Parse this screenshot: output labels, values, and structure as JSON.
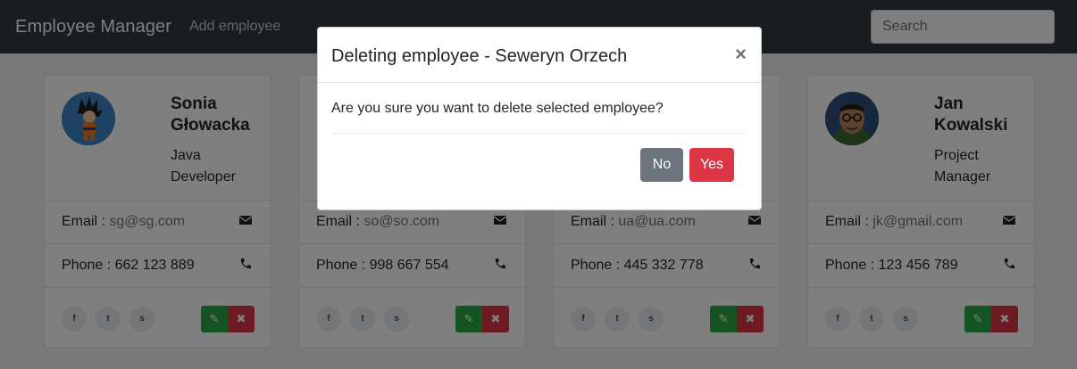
{
  "navbar": {
    "brand": "Employee Manager",
    "add_link": "Add employee",
    "search_placeholder": "Search"
  },
  "cards": [
    {
      "name": "Sonia Głowacka",
      "title": "Java Developer",
      "email_label": "Email :",
      "email": "sg@sg.com",
      "phone_label": "Phone :",
      "phone": "662 123 889"
    },
    {
      "name": "",
      "title": "",
      "email_label": "Email :",
      "email": "so@so.com",
      "phone_label": "Phone :",
      "phone": "998 667 554"
    },
    {
      "name": "",
      "title": "",
      "email_label": "Email :",
      "email": "ua@ua.com",
      "phone_label": "Phone :",
      "phone": "445 332 778"
    },
    {
      "name": "Jan Kowalski",
      "title": "Project Manager",
      "email_label": "Email :",
      "email": "jk@gmail.com",
      "phone_label": "Phone :",
      "phone": "123 456 789"
    }
  ],
  "social": {
    "facebook": "f",
    "twitter": "t",
    "skype": "s"
  },
  "modal": {
    "title": "Deleting employee - Seweryn Orzech",
    "close": "×",
    "body": "Are you sure you want to delete selected employee?",
    "no_label": "No",
    "yes_label": "Yes"
  },
  "colors": {
    "navbar": "#343a40",
    "success": "#28a745",
    "danger": "#dc3545",
    "secondary": "#6c757d"
  }
}
